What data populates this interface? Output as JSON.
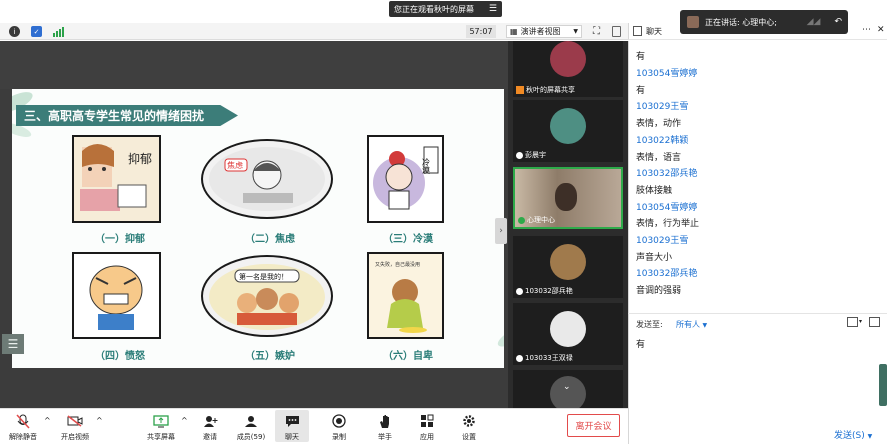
{
  "banner": {
    "text": "您正在观看秋叶的屏幕"
  },
  "toolbar": {
    "time": "57:07",
    "view_label": "演讲者视图"
  },
  "toast": {
    "text": "正在讲话: 心理中心;"
  },
  "chat_panel": {
    "title": "聊天"
  },
  "slide": {
    "title": "三、高职高专学生常见的情绪困扰",
    "items": [
      {
        "caption": "（一）抑郁",
        "text": "抑郁"
      },
      {
        "caption": "（二）焦虑",
        "text": "焦虑"
      },
      {
        "caption": "（三）冷漠",
        "text": "冷漠"
      },
      {
        "caption": "（四）愤怒"
      },
      {
        "caption": "（五）嫉妒",
        "text": "第一名是我的！"
      },
      {
        "caption": "（六）自卑",
        "text": "又失败，自己最没用"
      }
    ]
  },
  "participants": [
    {
      "name": "秋叶的屏幕共享"
    },
    {
      "name": "彭晨宇"
    },
    {
      "name": "心理中心"
    },
    {
      "name": "103032邵兵艳"
    },
    {
      "name": "103033王双禄"
    }
  ],
  "chat": {
    "messages": [
      {
        "text": "有",
        "type": "text"
      },
      {
        "text": "103054雪婷婷",
        "type": "name"
      },
      {
        "text": "有",
        "type": "text"
      },
      {
        "text": "103029王雪",
        "type": "name"
      },
      {
        "text": "表情，动作",
        "type": "text"
      },
      {
        "text": "103022韩颖",
        "type": "name"
      },
      {
        "text": "表情，语言",
        "type": "text"
      },
      {
        "text": "103032邵兵艳",
        "type": "name"
      },
      {
        "text": "肢体接触",
        "type": "text"
      },
      {
        "text": "103054雪婷婷",
        "type": "name"
      },
      {
        "text": "表情，行为举止",
        "type": "text"
      },
      {
        "text": "103029王雪",
        "type": "name"
      },
      {
        "text": "声音大小",
        "type": "text"
      },
      {
        "text": "103032邵兵艳",
        "type": "name"
      },
      {
        "text": "音调的强弱",
        "type": "text"
      }
    ],
    "send_to_label": "发送至:",
    "send_to_value": "所有人",
    "input_value": "有",
    "send_button": "发送(S)"
  },
  "bottom_toolbar": {
    "unmute": "解除静音",
    "video": "开启视频",
    "share": "共享屏幕",
    "invite": "邀请",
    "members": "成员(59)",
    "chat": "聊天",
    "record": "录制",
    "raise_hand": "举手",
    "apps": "应用",
    "settings": "设置",
    "leave": "离开会议"
  },
  "colors": {
    "accent": "#1a6fd1",
    "slide_title_bg": "#3c7d79",
    "caption": "#2a7d78",
    "leave": "#e24b4b"
  }
}
